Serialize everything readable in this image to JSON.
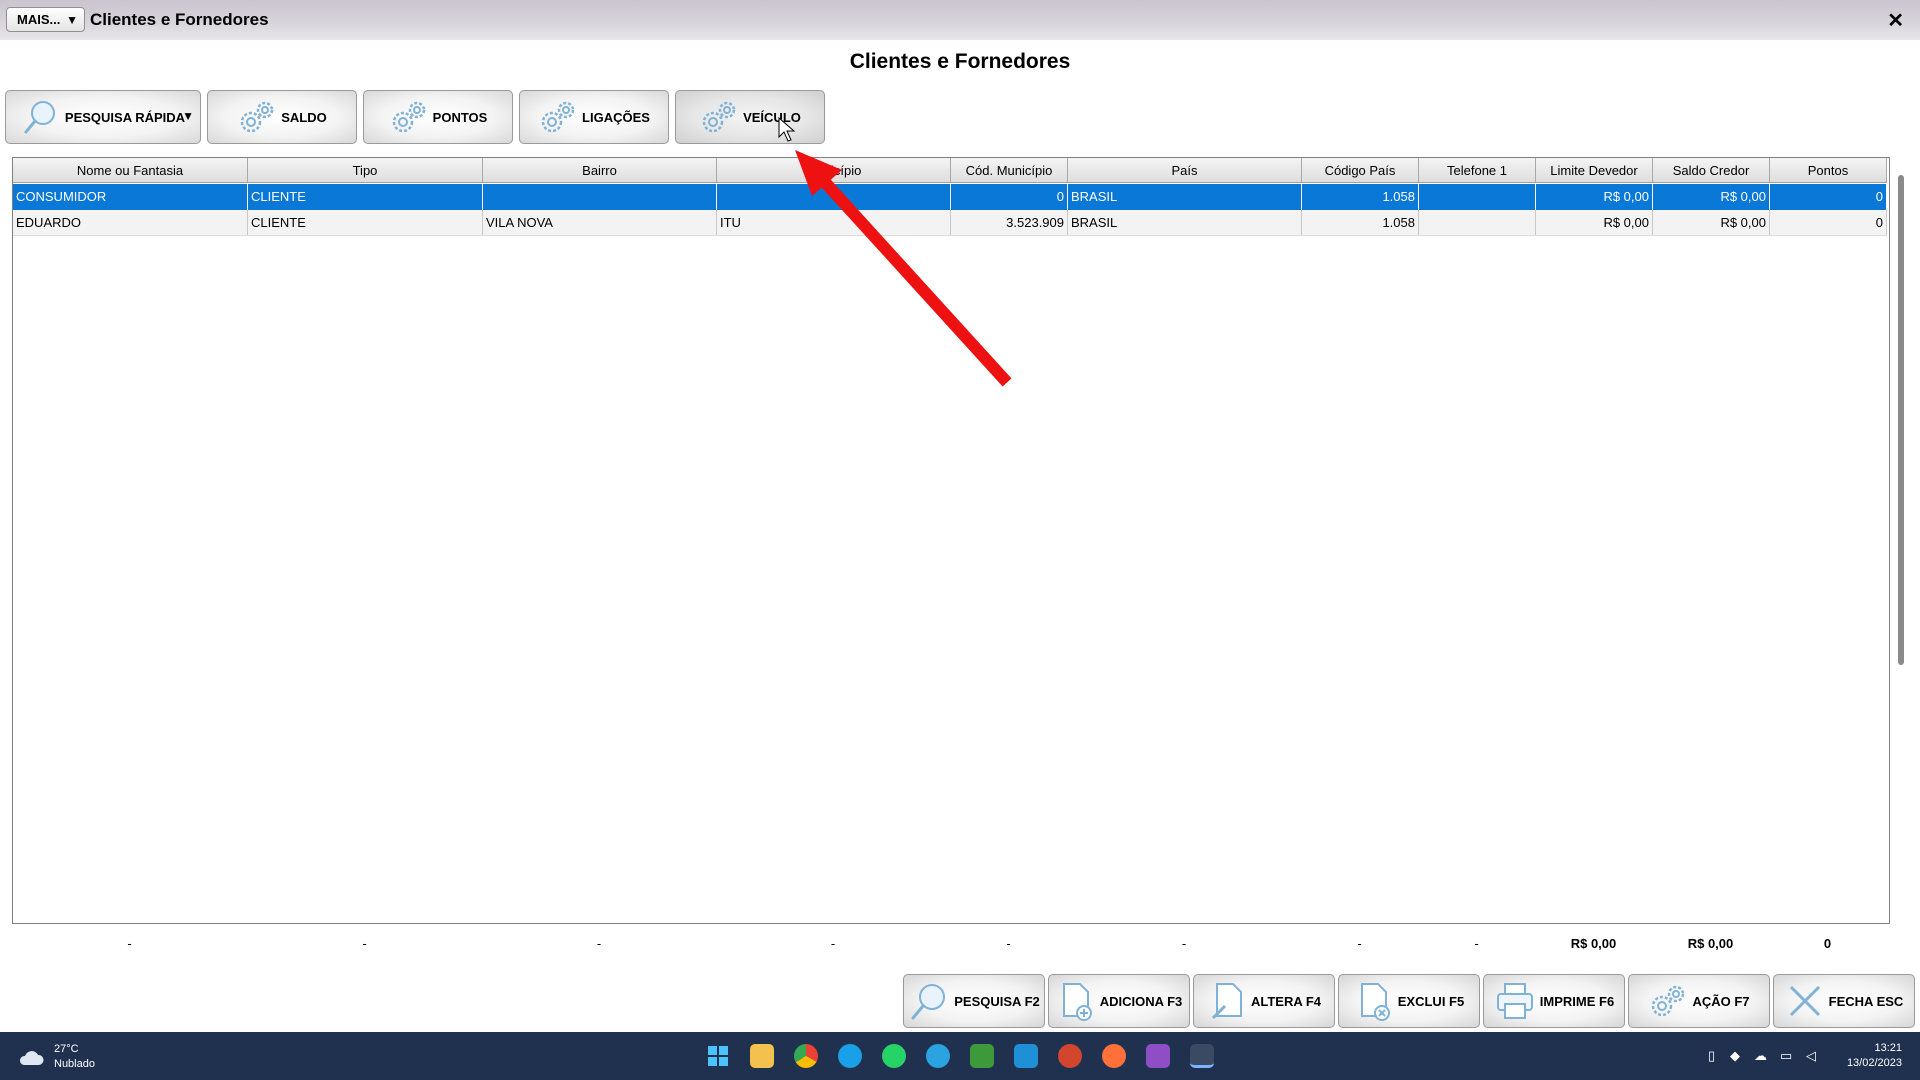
{
  "window": {
    "title": "Clientes e Fornedores",
    "mais_label": "MAIS...",
    "close_glyph": "✕",
    "header": "Clientes e Fornedores"
  },
  "toolbar": [
    {
      "label": "PESQUISA RÁPIDA",
      "icon": "magnifier-icon",
      "dropdown": true
    },
    {
      "label": "SALDO",
      "icon": "gear-icon"
    },
    {
      "label": "PONTOS",
      "icon": "gear-icon"
    },
    {
      "label": "LIGAÇÕES",
      "icon": "gear-icon"
    },
    {
      "label": "VEÍCULO",
      "icon": "gear-icon"
    }
  ],
  "grid": {
    "columns": [
      "Nome ou Fantasia",
      "Tipo",
      "Bairro",
      "Município",
      "Cód. Município",
      "País",
      "Código País",
      "Telefone 1",
      "Limite Devedor",
      "Saldo Credor",
      "Pontos"
    ],
    "rows": [
      [
        "CONSUMIDOR",
        "CLIENTE",
        "",
        "",
        "0",
        "BRASIL",
        "1.058",
        "",
        "R$ 0,00",
        "R$ 0,00",
        "0"
      ],
      [
        "EDUARDO",
        "CLIENTE",
        "VILA NOVA",
        "ITU",
        "3.523.909",
        "BRASIL",
        "1.058",
        "",
        "R$ 0,00",
        "R$ 0,00",
        "0"
      ]
    ],
    "selected_row": 0
  },
  "totals": [
    "-",
    "-",
    "-",
    "-",
    "-",
    "-",
    "-",
    "-",
    "R$ 0,00",
    "R$ 0,00",
    "0"
  ],
  "actions": [
    {
      "label": "PESQUISA F2",
      "icon": "magnifier-icon"
    },
    {
      "label": "ADICIONA F3",
      "icon": "add-document-icon"
    },
    {
      "label": "ALTERA F4",
      "icon": "edit-document-icon"
    },
    {
      "label": "EXCLUI F5",
      "icon": "delete-document-icon"
    },
    {
      "label": "IMPRIME F6",
      "icon": "printer-icon"
    },
    {
      "label": "AÇÃO F7",
      "icon": "gear-icon"
    },
    {
      "label": "FECHA ESC",
      "icon": "close-icon"
    }
  ],
  "taskbar": {
    "weather_temp": "27°C",
    "weather_desc": "Nublado",
    "time": "13:21",
    "date": "13/02/2023",
    "apps": [
      "windows-start-icon",
      "file-explorer-icon",
      "chrome-icon",
      "edge-icon",
      "whatsapp-icon",
      "telegram-icon",
      "spreadsheet-icon",
      "mail-icon",
      "app-icon",
      "firefox-icon",
      "media-icon",
      "erp-app-icon"
    ]
  },
  "colors": {
    "selected_row": "#0a78d7",
    "taskbar": "#20314f",
    "annotation_arrow": "#ee1111"
  }
}
